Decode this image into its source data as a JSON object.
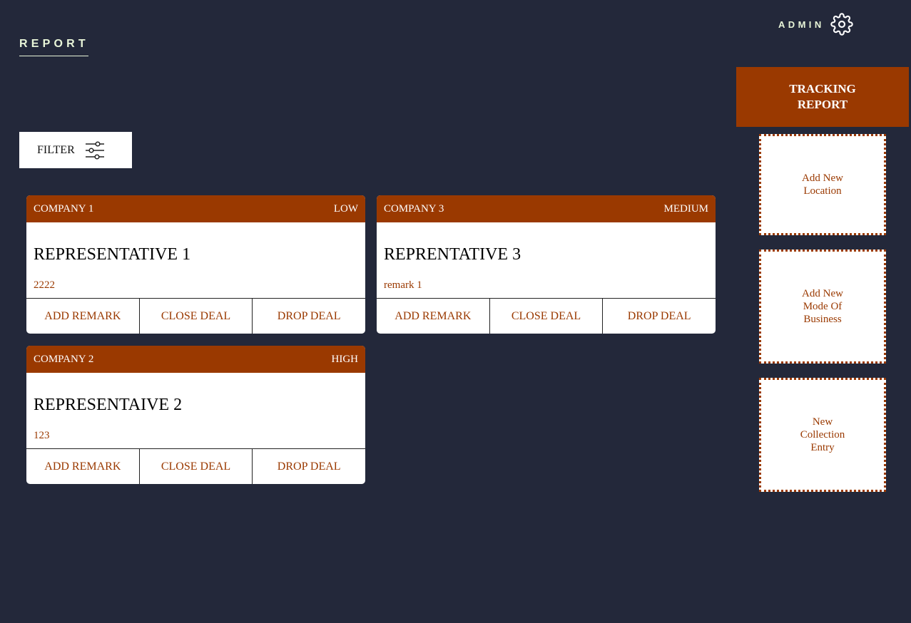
{
  "header": {
    "title": "REPORT",
    "user_label": "ADMIN",
    "settings_icon": "gear-icon"
  },
  "sidebar": {
    "tracking_report_label": "TRACKING REPORT",
    "tiles": [
      {
        "label": "Add New Location"
      },
      {
        "label": "Add New Mode Of Business"
      },
      {
        "label": "New Collection Entry"
      }
    ]
  },
  "filter": {
    "label": "FILTER",
    "icon": "sliders-icon"
  },
  "cards": [
    {
      "company": "COMPANY 1",
      "priority": "LOW",
      "representative": "REPRESENTATIVE 1",
      "remark": "2222",
      "actions": [
        "ADD REMARK",
        "CLOSE DEAL",
        "DROP DEAL"
      ]
    },
    {
      "company": "COMPANY 3",
      "priority": "MEDIUM",
      "representative": "REPRENTATIVE 3",
      "remark": "remark 1",
      "actions": [
        "ADD REMARK",
        "CLOSE DEAL",
        "DROP DEAL"
      ]
    },
    {
      "company": "COMPANY 2",
      "priority": "HIGH",
      "representative": "REPRESENTAIVE 2",
      "remark": "123",
      "actions": [
        "ADD REMARK",
        "CLOSE DEAL",
        "DROP DEAL"
      ]
    }
  ],
  "colors": {
    "background": "#23283a",
    "accent": "#9a3900",
    "heading_text": "#e8f5d8",
    "card_background": "#ffffff"
  }
}
